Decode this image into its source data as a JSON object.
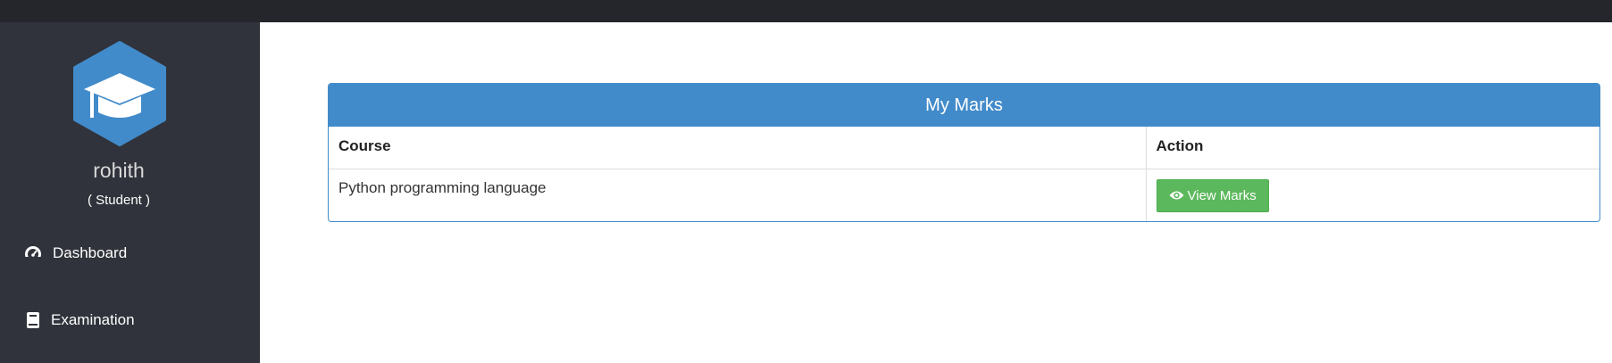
{
  "sidebar": {
    "user_name": "rohith",
    "user_role": "( Student )",
    "nav": [
      {
        "label": "Dashboard",
        "icon": "speedometer-icon"
      },
      {
        "label": "Examination",
        "icon": "book-icon"
      }
    ]
  },
  "panel": {
    "title": "My Marks",
    "columns": [
      "Course",
      "Action"
    ],
    "rows": [
      {
        "course": "Python programming language",
        "action_label": "View Marks",
        "action_icon": "eye-icon"
      }
    ]
  },
  "colors": {
    "topbar": "#25262c",
    "sidebar": "#30333b",
    "primary": "#428bca",
    "success": "#5cb85c"
  }
}
